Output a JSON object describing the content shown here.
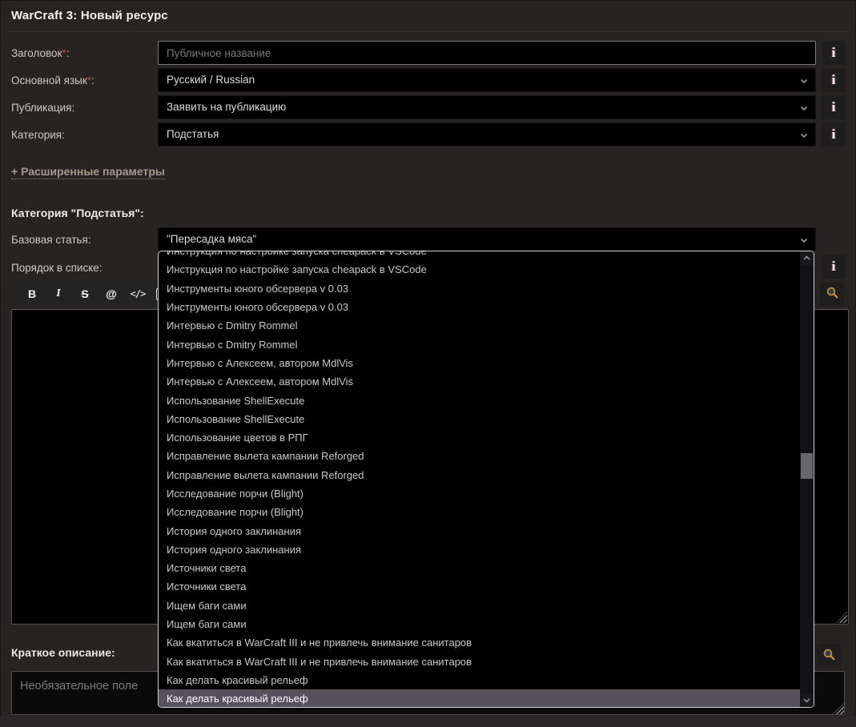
{
  "title": "WarCraft 3: Новый ресурс",
  "colon": ":",
  "fields": [
    {
      "label": "Заголовок",
      "mark": "*",
      "placeholder": "Публичное название"
    },
    {
      "label": "Основной язык",
      "mark": "*",
      "value": "Русский / Russian"
    },
    {
      "label": "Публикация",
      "mark": "",
      "value": "Заявить на публикацию"
    },
    {
      "label": "Категория",
      "mark": "",
      "value": "Подстатья"
    }
  ],
  "advanced_link": "+ Расширенные параметры",
  "subcategory": {
    "header": "Категория \"Подстатья\":",
    "base_label": "Базовая статья:",
    "base_value": "\"Пересадка мяса\"",
    "order_label": "Порядок в списке:"
  },
  "toolbar": {
    "bold": "B",
    "italic": "I",
    "strikethrough": "S",
    "link": "@",
    "code": "</>"
  },
  "icons": {
    "info": "i"
  },
  "dropdown": {
    "highlighted_index": 24,
    "items": [
      "Инструкция по настройке запуска cheapack в VSCode",
      "Инструкция по настройке запуска cheapack в VSCode",
      "Инструменты юного обсервера v 0.03",
      "Инструменты юного обсервера v 0.03",
      "Интервью с Dmitry Rommel",
      "Интервью с Dmitry Rommel",
      "Интервью с Алексеем, автором MdlVis",
      "Интервью с Алексеем, автором MdlVis",
      "Использование ShellExecute",
      "Использование ShellExecute",
      "Использование цветов в РПГ",
      "Исправление вылета кампании Reforged",
      "Исправление вылета кампании Reforged",
      "Исследование порчи (Blight)",
      "Исследование порчи (Blight)",
      "История одного заклинания",
      "История одного заклинания",
      "Источники света",
      "Источники света",
      "Ищем баги сами",
      "Ищем баги сами",
      "Как вкатиться в WarCraft III и не привлечь внимание санитаров",
      "Как вкатиться в WarCraft III и не привлечь внимание санитаров",
      "Как делать красивый рельеф",
      "Как делать красивый рельеф"
    ]
  },
  "short_description": {
    "label": "Краткое описание:",
    "placeholder": "Необязательное поле"
  },
  "colors": {
    "background": "#272322",
    "field_background": "#000000",
    "highlight": "#56525c",
    "link": "#a29a8c",
    "required": "#c44b3e",
    "dropdown_border": "#cfcfcf",
    "search_icon": "#c08a3e"
  }
}
